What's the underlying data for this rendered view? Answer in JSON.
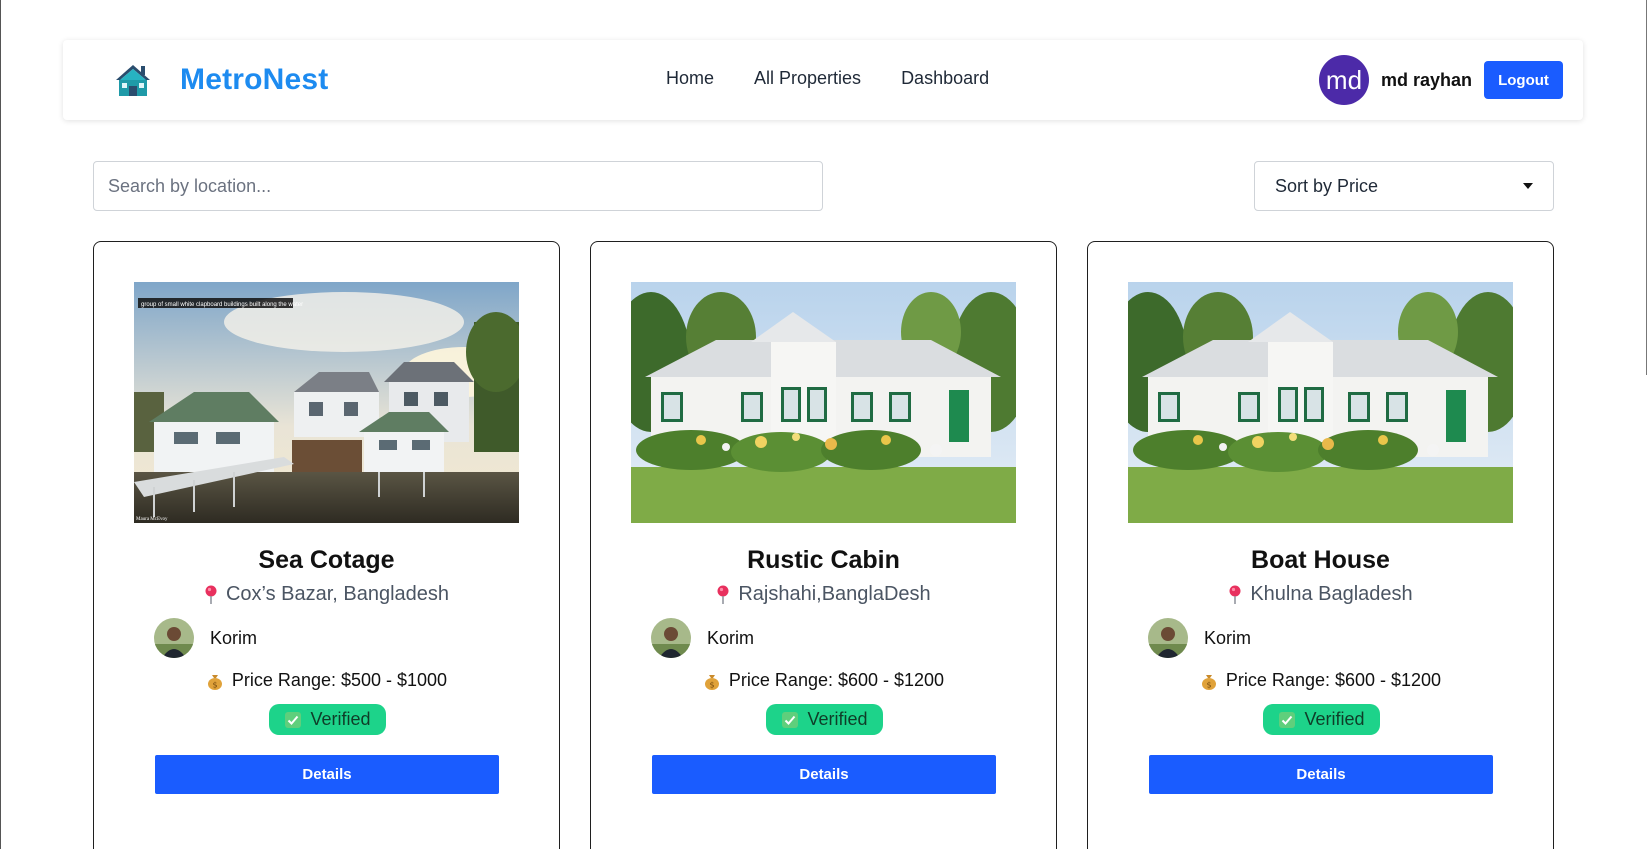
{
  "brand": {
    "name": "MetroNest",
    "icon": "house-icon"
  },
  "nav": {
    "links": [
      "Home",
      "All Properties",
      "Dashboard"
    ]
  },
  "user": {
    "initials": "md",
    "name": "md rayhan",
    "logout_label": "Logout"
  },
  "filters": {
    "search_placeholder": "Search by location...",
    "search_value": "",
    "sort_label": "Sort by Price"
  },
  "colors": {
    "brand": "#1d8bf0",
    "primary_button": "#1a5cff",
    "avatar_bg": "#4c2aa8",
    "verified_bg": "#1dd38a"
  },
  "properties": [
    {
      "title": "Sea Cotage",
      "location": "Cox’s Bazar, Bangladesh",
      "agent": "Korim",
      "price": "Price Range: $500 - $1000",
      "status": "Verified",
      "details_label": "Details",
      "image_caption": "group of small white clapboard buildings built along the water",
      "image_credit": "Maura McEvoy"
    },
    {
      "title": "Rustic Cabin",
      "location": "Rajshahi,BanglaDesh",
      "agent": "Korim",
      "price": "Price Range: $600 - $1200",
      "status": "Verified",
      "details_label": "Details"
    },
    {
      "title": "Boat House",
      "location": "Khulna Bagladesh",
      "agent": "Korim",
      "price": "Price Range: $600 - $1200",
      "status": "Verified",
      "details_label": "Details"
    }
  ]
}
